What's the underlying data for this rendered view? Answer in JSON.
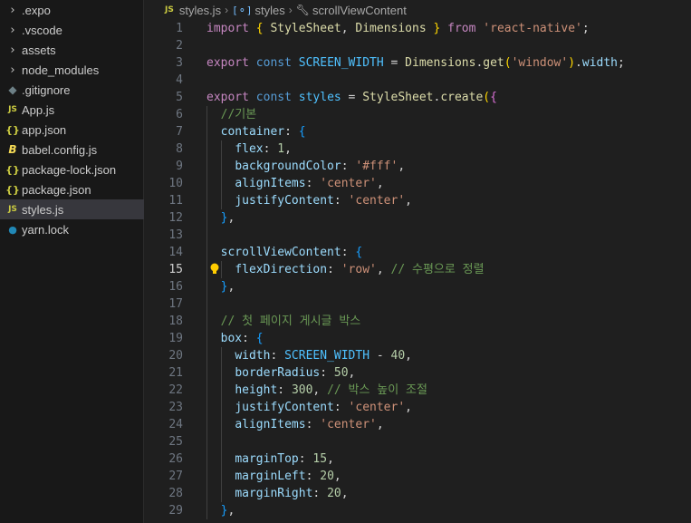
{
  "explorer": {
    "items": [
      {
        "label": ".expo",
        "icon": "chevron-right-icon"
      },
      {
        "label": ".vscode",
        "icon": "chevron-right-icon"
      },
      {
        "label": "assets",
        "icon": "chevron-right-icon"
      },
      {
        "label": "node_modules",
        "icon": "chevron-right-icon"
      },
      {
        "label": ".gitignore",
        "icon": "git-icon"
      },
      {
        "label": "App.js",
        "icon": "js-icon"
      },
      {
        "label": "app.json",
        "icon": "json-icon"
      },
      {
        "label": "babel.config.js",
        "icon": "babel-icon"
      },
      {
        "label": "package-lock.json",
        "icon": "json-icon"
      },
      {
        "label": "package.json",
        "icon": "json-icon"
      },
      {
        "label": "styles.js",
        "icon": "js-icon",
        "selected": true
      },
      {
        "label": "yarn.lock",
        "icon": "yarn-icon"
      }
    ]
  },
  "breadcrumb": {
    "file": "styles.js",
    "symbol1": "styles",
    "symbol2": "scrollViewContent"
  },
  "editor": {
    "active_line": 15,
    "lines": [
      {
        "n": "1",
        "tokens": [
          [
            "kw",
            "import"
          ],
          [
            "p",
            " "
          ],
          [
            "br1",
            "{"
          ],
          [
            "p",
            " "
          ],
          [
            "fn",
            "StyleSheet"
          ],
          [
            "p",
            ", "
          ],
          [
            "fn",
            "Dimensions"
          ],
          [
            "p",
            " "
          ],
          [
            "br1",
            "}"
          ],
          [
            "p",
            " "
          ],
          [
            "kw",
            "from"
          ],
          [
            "p",
            " "
          ],
          [
            "str",
            "'react-native'"
          ],
          [
            "p",
            ";"
          ]
        ]
      },
      {
        "n": "2",
        "tokens": []
      },
      {
        "n": "3",
        "tokens": [
          [
            "kw",
            "export"
          ],
          [
            "p",
            " "
          ],
          [
            "decl",
            "const"
          ],
          [
            "p",
            " "
          ],
          [
            "const",
            "SCREEN_WIDTH"
          ],
          [
            "p",
            " = "
          ],
          [
            "fn",
            "Dimensions"
          ],
          [
            "p",
            "."
          ],
          [
            "fn",
            "get"
          ],
          [
            "br1",
            "("
          ],
          [
            "str",
            "'window'"
          ],
          [
            "br1",
            ")"
          ],
          [
            "p",
            "."
          ],
          [
            "prop",
            "width"
          ],
          [
            "p",
            ";"
          ]
        ]
      },
      {
        "n": "4",
        "tokens": []
      },
      {
        "n": "5",
        "tokens": [
          [
            "kw",
            "export"
          ],
          [
            "p",
            " "
          ],
          [
            "decl",
            "const"
          ],
          [
            "p",
            " "
          ],
          [
            "const",
            "styles"
          ],
          [
            "p",
            " = "
          ],
          [
            "fn",
            "StyleSheet"
          ],
          [
            "p",
            "."
          ],
          [
            "fn",
            "create"
          ],
          [
            "br1",
            "("
          ],
          [
            "br2",
            "{"
          ]
        ]
      },
      {
        "n": "6",
        "tokens": [
          [
            "p",
            "  "
          ],
          [
            "cmt",
            "//기본"
          ]
        ]
      },
      {
        "n": "7",
        "tokens": [
          [
            "p",
            "  "
          ],
          [
            "prop",
            "container"
          ],
          [
            "p",
            ": "
          ],
          [
            "br3",
            "{"
          ]
        ]
      },
      {
        "n": "8",
        "tokens": [
          [
            "p",
            "    "
          ],
          [
            "prop",
            "flex"
          ],
          [
            "p",
            ": "
          ],
          [
            "num",
            "1"
          ],
          [
            "p",
            ","
          ]
        ]
      },
      {
        "n": "9",
        "tokens": [
          [
            "p",
            "    "
          ],
          [
            "prop",
            "backgroundColor"
          ],
          [
            "p",
            ": "
          ],
          [
            "str",
            "'#fff'"
          ],
          [
            "p",
            ","
          ]
        ]
      },
      {
        "n": "10",
        "tokens": [
          [
            "p",
            "    "
          ],
          [
            "prop",
            "alignItems"
          ],
          [
            "p",
            ": "
          ],
          [
            "str",
            "'center'"
          ],
          [
            "p",
            ","
          ]
        ]
      },
      {
        "n": "11",
        "tokens": [
          [
            "p",
            "    "
          ],
          [
            "prop",
            "justifyContent"
          ],
          [
            "p",
            ": "
          ],
          [
            "str",
            "'center'"
          ],
          [
            "p",
            ","
          ]
        ]
      },
      {
        "n": "12",
        "tokens": [
          [
            "p",
            "  "
          ],
          [
            "br3",
            "}"
          ],
          [
            "p",
            ","
          ]
        ]
      },
      {
        "n": "13",
        "tokens": []
      },
      {
        "n": "14",
        "tokens": [
          [
            "p",
            "  "
          ],
          [
            "prop",
            "scrollViewContent"
          ],
          [
            "p",
            ": "
          ],
          [
            "br3",
            "{"
          ]
        ]
      },
      {
        "n": "15",
        "tokens": [
          [
            "p",
            "    "
          ],
          [
            "prop",
            "flexDirection"
          ],
          [
            "p",
            ": "
          ],
          [
            "str",
            "'row'"
          ],
          [
            "p",
            ", "
          ],
          [
            "cmt",
            "// 수평으로 정렬"
          ]
        ]
      },
      {
        "n": "16",
        "tokens": [
          [
            "p",
            "  "
          ],
          [
            "br3",
            "}"
          ],
          [
            "p",
            ","
          ]
        ]
      },
      {
        "n": "17",
        "tokens": []
      },
      {
        "n": "18",
        "tokens": [
          [
            "p",
            "  "
          ],
          [
            "cmt",
            "// 첫 페이지 게시글 박스"
          ]
        ]
      },
      {
        "n": "19",
        "tokens": [
          [
            "p",
            "  "
          ],
          [
            "prop",
            "box"
          ],
          [
            "p",
            ": "
          ],
          [
            "br3",
            "{"
          ]
        ]
      },
      {
        "n": "20",
        "tokens": [
          [
            "p",
            "    "
          ],
          [
            "prop",
            "width"
          ],
          [
            "p",
            ": "
          ],
          [
            "const",
            "SCREEN_WIDTH"
          ],
          [
            "p",
            " - "
          ],
          [
            "num",
            "40"
          ],
          [
            "p",
            ","
          ]
        ]
      },
      {
        "n": "21",
        "tokens": [
          [
            "p",
            "    "
          ],
          [
            "prop",
            "borderRadius"
          ],
          [
            "p",
            ": "
          ],
          [
            "num",
            "50"
          ],
          [
            "p",
            ","
          ]
        ]
      },
      {
        "n": "22",
        "tokens": [
          [
            "p",
            "    "
          ],
          [
            "prop",
            "height"
          ],
          [
            "p",
            ": "
          ],
          [
            "num",
            "300"
          ],
          [
            "p",
            ", "
          ],
          [
            "cmt",
            "// 박스 높이 조절"
          ]
        ]
      },
      {
        "n": "23",
        "tokens": [
          [
            "p",
            "    "
          ],
          [
            "prop",
            "justifyContent"
          ],
          [
            "p",
            ": "
          ],
          [
            "str",
            "'center'"
          ],
          [
            "p",
            ","
          ]
        ]
      },
      {
        "n": "24",
        "tokens": [
          [
            "p",
            "    "
          ],
          [
            "prop",
            "alignItems"
          ],
          [
            "p",
            ": "
          ],
          [
            "str",
            "'center'"
          ],
          [
            "p",
            ","
          ]
        ]
      },
      {
        "n": "25",
        "tokens": []
      },
      {
        "n": "26",
        "tokens": [
          [
            "p",
            "    "
          ],
          [
            "prop",
            "marginTop"
          ],
          [
            "p",
            ": "
          ],
          [
            "num",
            "15"
          ],
          [
            "p",
            ","
          ]
        ]
      },
      {
        "n": "27",
        "tokens": [
          [
            "p",
            "    "
          ],
          [
            "prop",
            "marginLeft"
          ],
          [
            "p",
            ": "
          ],
          [
            "num",
            "20"
          ],
          [
            "p",
            ","
          ]
        ]
      },
      {
        "n": "28",
        "tokens": [
          [
            "p",
            "    "
          ],
          [
            "prop",
            "marginRight"
          ],
          [
            "p",
            ": "
          ],
          [
            "num",
            "20"
          ],
          [
            "p",
            ","
          ]
        ]
      },
      {
        "n": "29",
        "tokens": [
          [
            "p",
            "  "
          ],
          [
            "br3",
            "}"
          ],
          [
            "p",
            ","
          ]
        ]
      }
    ]
  }
}
